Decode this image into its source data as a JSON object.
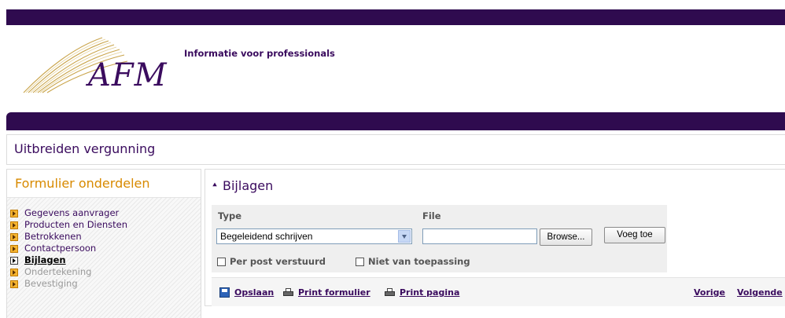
{
  "brand": {
    "logo_text": "AFM",
    "tagline": "Informatie voor professionals",
    "primary_color": "#2f0b4f",
    "accent_color": "#d88a00"
  },
  "page": {
    "title": "Uitbreiden vergunning"
  },
  "sidebar": {
    "title": "Formulier onderdelen",
    "items": [
      {
        "label": "Gegevens aanvrager",
        "state": "link"
      },
      {
        "label": "Producten en Diensten",
        "state": "link"
      },
      {
        "label": "Betrokkenen",
        "state": "link"
      },
      {
        "label": "Contactpersoon",
        "state": "link"
      },
      {
        "label": "Bijlagen",
        "state": "active"
      },
      {
        "label": "Ondertekening",
        "state": "disabled"
      },
      {
        "label": "Bevestiging",
        "state": "disabled"
      }
    ]
  },
  "section": {
    "title": "Bijlagen",
    "collapse_icon": "double-chevron-up-icon"
  },
  "form": {
    "type_label": "Type",
    "file_label": "File",
    "type_selected": "Begeleidend schrijven",
    "file_value": "",
    "browse_label": "Browse...",
    "add_label": "Voeg toe",
    "checkbox_post": "Per post verstuurd",
    "checkbox_na": "Niet van toepassing"
  },
  "toolbar": {
    "save_label": "Opslaan",
    "print_form_label": "Print formulier",
    "print_page_label": "Print pagina",
    "prev_label": "Vorige",
    "next_label": "Volgende"
  }
}
